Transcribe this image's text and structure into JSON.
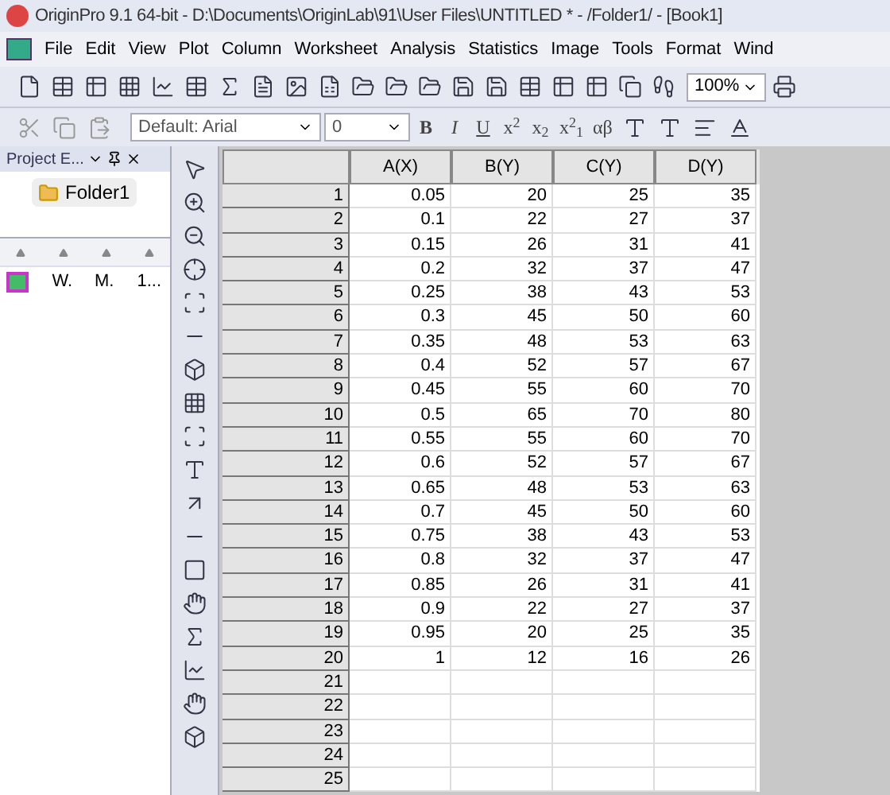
{
  "window": {
    "title": "OriginPro 9.1 64-bit - D:\\Documents\\OriginLab\\91\\User Files\\UNTITLED * - /Folder1/ - [Book1]"
  },
  "menu": [
    "File",
    "Edit",
    "View",
    "Plot",
    "Column",
    "Worksheet",
    "Analysis",
    "Statistics",
    "Image",
    "Tools",
    "Format",
    "Wind"
  ],
  "toolbar": {
    "zoom": "100%"
  },
  "format_bar": {
    "font": "Default: Arial",
    "size": "0",
    "buttons": [
      "B",
      "I",
      "U",
      "x$^{2}$",
      "x$_{2}$",
      "x$^{2}$$_{1}$",
      "αβ"
    ]
  },
  "project_explorer": {
    "title": "Project E...",
    "folder": "Folder1",
    "items": [
      {
        "cells": [
          "W.",
          "M.",
          "1..."
        ]
      }
    ]
  },
  "worksheet": {
    "columns": [
      "A(X)",
      "B(Y)",
      "C(Y)",
      "D(Y)"
    ],
    "rows": [
      [
        "1",
        "0.05",
        "20",
        "25",
        "35"
      ],
      [
        "2",
        "0.1",
        "22",
        "27",
        "37"
      ],
      [
        "3",
        "0.15",
        "26",
        "31",
        "41"
      ],
      [
        "4",
        "0.2",
        "32",
        "37",
        "47"
      ],
      [
        "5",
        "0.25",
        "38",
        "43",
        "53"
      ],
      [
        "6",
        "0.3",
        "45",
        "50",
        "60"
      ],
      [
        "7",
        "0.35",
        "48",
        "53",
        "63"
      ],
      [
        "8",
        "0.4",
        "52",
        "57",
        "67"
      ],
      [
        "9",
        "0.45",
        "55",
        "60",
        "70"
      ],
      [
        "10",
        "0.5",
        "65",
        "70",
        "80"
      ],
      [
        "11",
        "0.55",
        "55",
        "60",
        "70"
      ],
      [
        "12",
        "0.6",
        "52",
        "57",
        "67"
      ],
      [
        "13",
        "0.65",
        "48",
        "53",
        "63"
      ],
      [
        "14",
        "0.7",
        "45",
        "50",
        "60"
      ],
      [
        "15",
        "0.75",
        "38",
        "43",
        "53"
      ],
      [
        "16",
        "0.8",
        "32",
        "37",
        "47"
      ],
      [
        "17",
        "0.85",
        "26",
        "31",
        "41"
      ],
      [
        "18",
        "0.9",
        "22",
        "27",
        "37"
      ],
      [
        "19",
        "0.95",
        "20",
        "25",
        "35"
      ],
      [
        "20",
        "1",
        "12",
        "16",
        "26"
      ],
      [
        "21",
        "",
        "",
        "",
        ""
      ],
      [
        "22",
        "",
        "",
        "",
        ""
      ],
      [
        "23",
        "",
        "",
        "",
        ""
      ],
      [
        "24",
        "",
        "",
        "",
        ""
      ],
      [
        "25",
        "",
        "",
        "",
        ""
      ]
    ]
  }
}
